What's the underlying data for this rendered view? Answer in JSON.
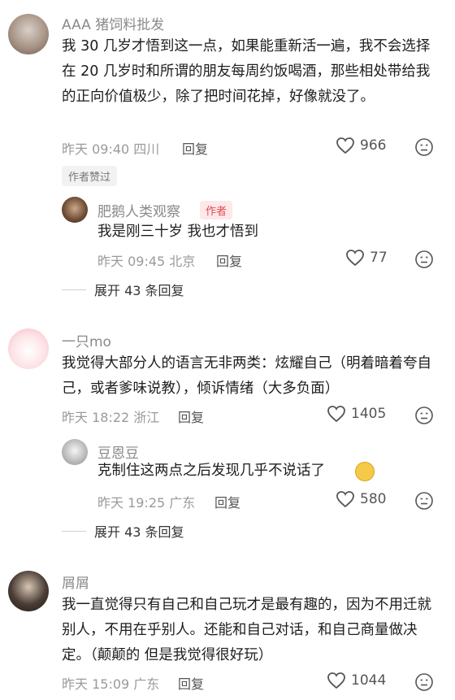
{
  "comments": [
    {
      "name": "AAA 猪饲料批发",
      "text": "我 30 几岁才悟到这一点，如果能重新活一遍，我不会选择在 20 几岁时和所谓的朋友每周约饭喝酒，那些相处带给我的正向价值极少，除了把时间花掉，好像就没了。",
      "time": "昨天 09:40 四川",
      "reply_label": "回复",
      "likes": "966",
      "badge": "作者赞过"
    },
    {
      "name": "肥鹅人类观察",
      "author_tag": "作者",
      "text": "我是刚三十岁 我也才悟到",
      "time": "昨天 09:45 北京",
      "reply_label": "回复",
      "likes": "77"
    },
    {
      "expand": "展开 43 条回复"
    },
    {
      "name": "一只mo",
      "text": "我觉得大部分人的语言无非两类：炫耀自己（明着暗着夸自己，或者爹味说教），倾诉情绪（大多负面）",
      "time": "昨天 18:22 浙江",
      "reply_label": "回复",
      "likes": "1405"
    },
    {
      "name": "豆恩豆",
      "text": "克制住这两点之后发现几乎不说话了",
      "time": "昨天 19:25 广东",
      "reply_label": "回复",
      "likes": "580"
    },
    {
      "expand": "展开 43 条回复"
    },
    {
      "name": "屑屑",
      "text": "我一直觉得只有自己和自己玩才是最有趣的，因为不用迁就别人，不用在乎别人。还能和自己对话，和自己商量做决定。（颠颠的 但是我觉得很好玩）",
      "time": "昨天 15:09 广东",
      "reply_label": "回复",
      "likes": "1044"
    }
  ],
  "icons": {
    "like": "heart-outline-icon",
    "dislike": "dislike-face-icon",
    "emoji": "laughing-emoji-icon"
  },
  "colors": {
    "author_tag_bg": "#fde9ea",
    "author_tag_fg": "#e5484d",
    "meta": "#9a9a9a"
  }
}
